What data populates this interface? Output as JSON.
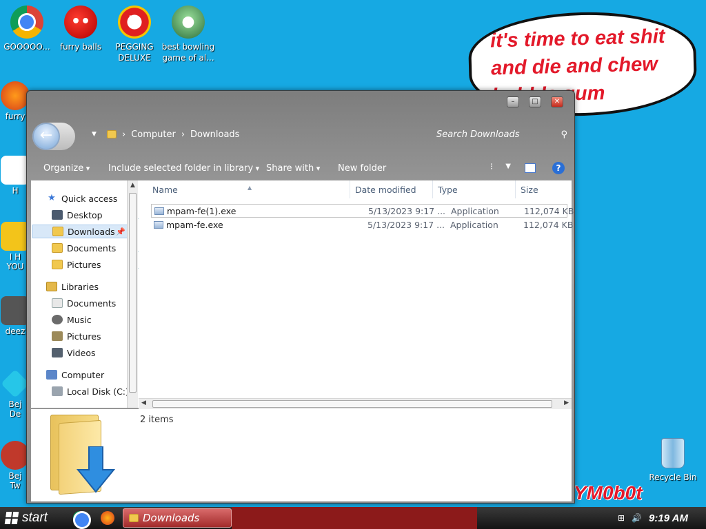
{
  "desktop": {
    "icons": [
      {
        "label": "GOOOOO...",
        "icon": "chrome-icon"
      },
      {
        "label": "furry balls",
        "icon": "furry-balls-icon"
      },
      {
        "label": "PEGGING DELUXE",
        "icon": "pegging-icon"
      },
      {
        "label": "best bowling game of al...",
        "icon": "bowling-icon"
      }
    ],
    "partial_labels": [
      "furry",
      "H",
      "I H\nYOU",
      "deez",
      "Bej\nDe",
      "Bej\nTw"
    ],
    "speech_bubble": "it's time to eat shit and die and chew bubble gum",
    "signature": "YM0b0t",
    "recycle_bin": "Recycle Bin"
  },
  "window": {
    "title_controls": {
      "minimize": "–",
      "maximize": "□",
      "close": "✕"
    },
    "breadcrumb": [
      "Computer",
      "Downloads"
    ],
    "search_placeholder": "Search Downloads",
    "toolbar": {
      "organize": "Organize",
      "include": "Include selected folder in library",
      "share": "Share with",
      "new_folder": "New folder"
    },
    "nav": {
      "quick_access": "Quick access",
      "desktop": "Desktop",
      "downloads": "Downloads",
      "documents": "Documents",
      "pictures": "Pictures",
      "libraries": "Libraries",
      "lib_documents": "Documents",
      "music": "Music",
      "lib_pictures": "Pictures",
      "videos": "Videos",
      "computer": "Computer",
      "local_disk": "Local Disk (C:)"
    },
    "columns": {
      "name": "Name",
      "date": "Date modified",
      "type": "Type",
      "size": "Size"
    },
    "files": [
      {
        "name": "mpam-fe(1).exe",
        "date": "5/13/2023 9:17 ...",
        "type": "Application",
        "size": "112,074 KB"
      },
      {
        "name": "mpam-fe.exe",
        "date": "5/13/2023 9:17 ...",
        "type": "Application",
        "size": "112,074 KB"
      }
    ],
    "item_count": "2 items"
  },
  "taskbar": {
    "start": "start",
    "active_task": "Downloads",
    "clock": "9:19 AM"
  },
  "colors": {
    "desktop": "#16a9e3",
    "bubble_text": "#e3192a",
    "taskbar_task": "#a32b2b"
  }
}
